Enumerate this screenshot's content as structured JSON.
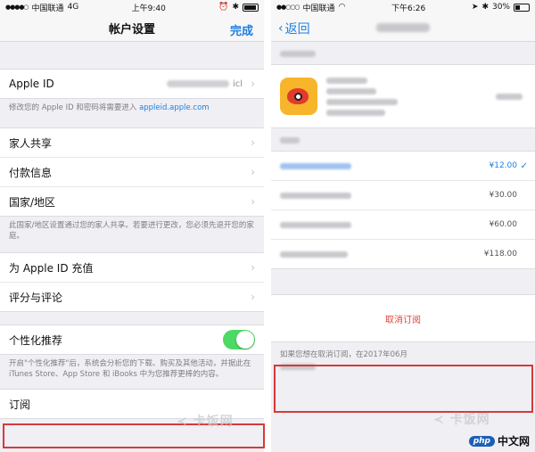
{
  "left": {
    "status": {
      "carrier": "中国联通",
      "network": "4G",
      "time": "上午9:40"
    },
    "nav": {
      "title": "帐户设置",
      "done": "完成"
    },
    "apple_id": {
      "label": "Apple ID",
      "value_suffix": "icl"
    },
    "apple_id_note": {
      "text": "修改您的 Apple ID 和密码将需要进入 ",
      "link": "appleid.apple.com"
    },
    "group2": [
      {
        "label": "家人共享"
      },
      {
        "label": "付款信息"
      },
      {
        "label": "国家/地区"
      }
    ],
    "region_note": "此国家/地区设置通过您的家人共享。若要进行更改，您必须先退开您的家庭。",
    "group3": [
      {
        "label": "为 Apple ID 充值"
      },
      {
        "label": "评分与评论"
      }
    ],
    "personalized": {
      "label": "个性化推荐",
      "on": true
    },
    "personalized_note": "开启\"个性化推荐\"后，系统会分析您的下载、购买及其他活动，并据此在 iTunes Store、App Store 和 iBooks 中为您推荐更棒的内容。",
    "subscription": {
      "label": "订阅"
    }
  },
  "right": {
    "status": {
      "carrier": "中国联通",
      "network": "",
      "time": "下午6:26",
      "battery": "30%"
    },
    "nav": {
      "back": "返回"
    },
    "prices": [
      "¥12.00",
      "¥30.00",
      "¥60.00",
      "¥118.00"
    ],
    "cancel": "取消订阅",
    "footer_note": "如果您想在取消订阅，在2017年06月"
  },
  "watermarks": {
    "ka": "卡饭网",
    "php": "php",
    "php_cn": "中文网"
  },
  "colors": {
    "accent": "#1f7fe0",
    "toggle_on": "#4cd964",
    "destructive": "#e0423a",
    "highlight_box": "#d63a3a"
  }
}
